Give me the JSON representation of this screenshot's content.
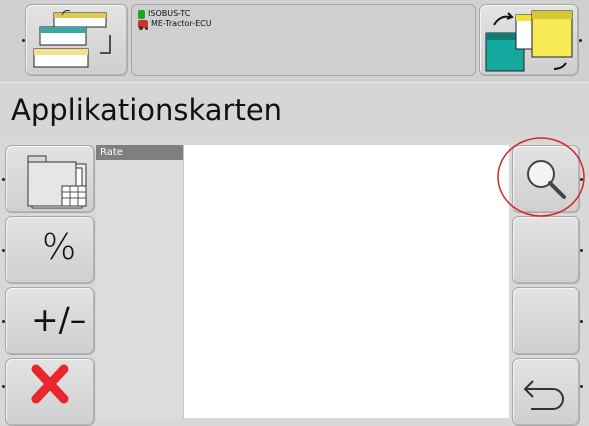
{
  "header": {
    "title": "Applikationskarten",
    "status_lines": [
      {
        "icon": "green-device-icon",
        "text": "ISOBUS-TC"
      },
      {
        "icon": "tractor-icon",
        "text": "ME-Tractor-ECU"
      }
    ]
  },
  "left_toolbar": {
    "percent_label": "%",
    "plus_minus_label": "+/–"
  },
  "list": {
    "header": "Rate",
    "items": []
  },
  "colors": {
    "highlight_circle": "#d3262b",
    "cancel": "#e8262b"
  }
}
